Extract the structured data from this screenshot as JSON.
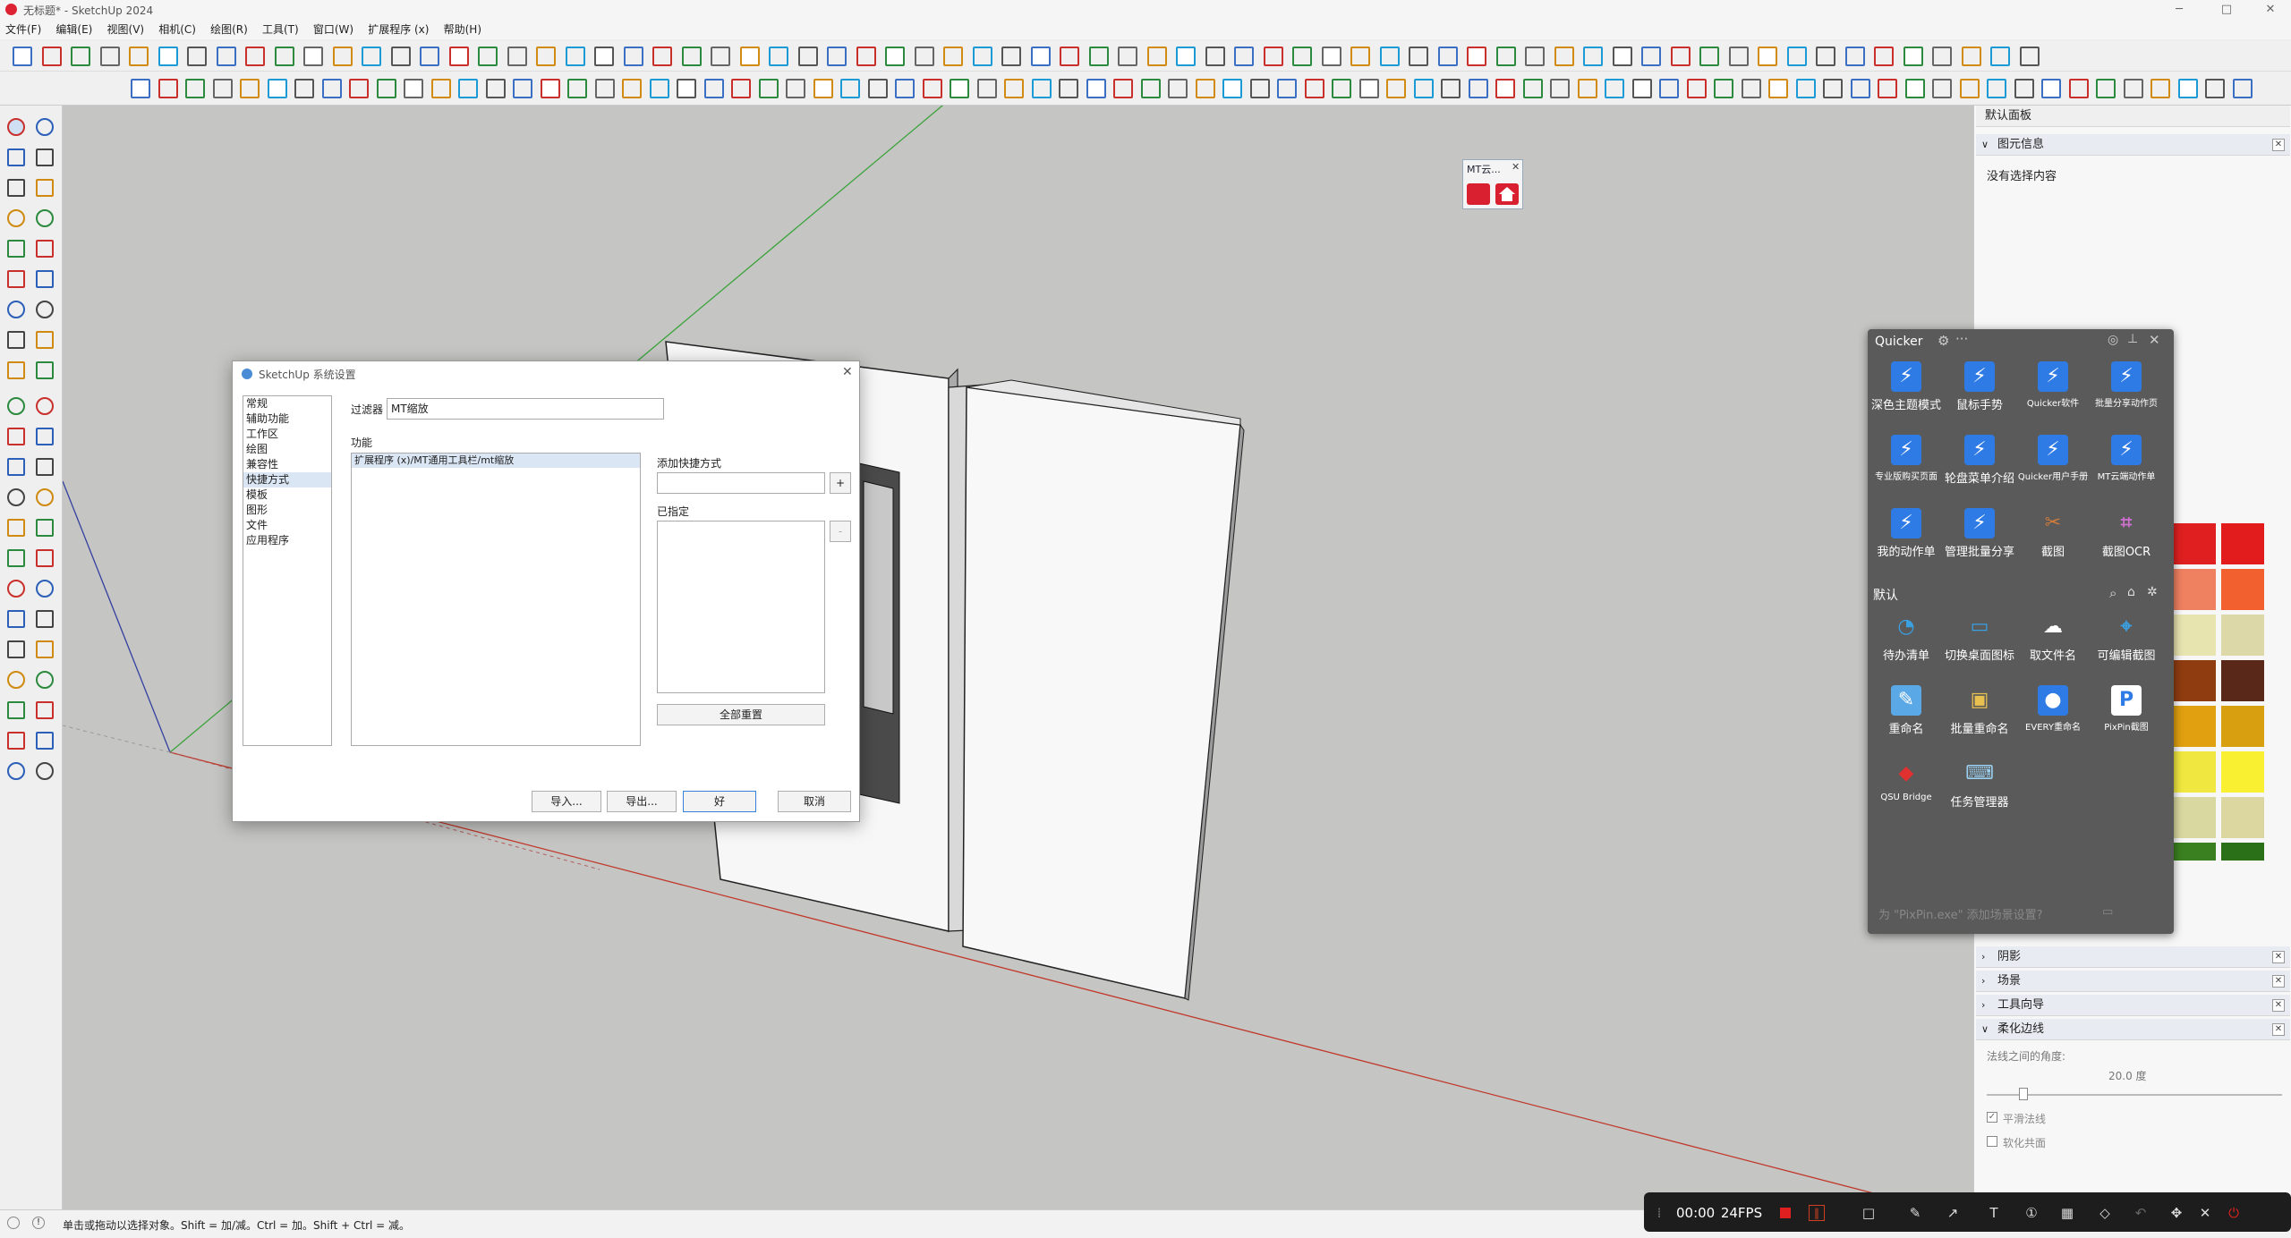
{
  "window": {
    "title": "无标题* - SketchUp 2024",
    "minimize": "─",
    "maximize": "□",
    "close": "✕"
  },
  "menu": [
    "文件(F)",
    "编辑(E)",
    "视图(V)",
    "相机(C)",
    "绘图(R)",
    "工具(T)",
    "窗口(W)",
    "扩展程序 (x)",
    "帮助(H)"
  ],
  "mt_panel": {
    "title": "MT云...",
    "close": "✕"
  },
  "dialog": {
    "title": "SketchUp 系统设置",
    "close": "✕",
    "nav": [
      "常规",
      "辅助功能",
      "工作区",
      "绘图",
      "兼容性",
      "快捷方式",
      "模板",
      "图形",
      "文件",
      "应用程序"
    ],
    "selected_nav": "快捷方式",
    "filter_label": "过滤器",
    "filter_value": "MT缩放",
    "function_label": "功能",
    "function_item": "扩展程序 (x)/MT通用工具栏/mt缩放",
    "add_shortcut_label": "添加快捷方式",
    "add_btn": "+",
    "assigned_label": "已指定",
    "remove_btn": "-",
    "reset_all": "全部重置",
    "import": "导入...",
    "export": "导出...",
    "ok": "好",
    "cancel": "取消"
  },
  "right_panel": {
    "title": "默认面板",
    "entity_info": "图元信息",
    "no_selection": "没有选择内容",
    "rows": [
      "阴影",
      "场景",
      "工具向导",
      "柔化边线"
    ],
    "soften_angle_label": "法线之间的角度:",
    "soften_angle_value": "20.0  度",
    "smooth_normals": "平滑法线",
    "soften_coplanar": "软化共面"
  },
  "quicker": {
    "title": "Quicker",
    "section_default": "默认",
    "top_items": [
      {
        "label": "深色主题模式",
        "icon": "lightning-icon"
      },
      {
        "label": "鼠标手势",
        "icon": "lightning-icon"
      },
      {
        "label": "Quicker软件",
        "icon": "lightning-icon"
      },
      {
        "label": "批量分享动作页",
        "icon": "lightning-icon"
      },
      {
        "label": "专业版购买页面",
        "icon": "lightning-icon"
      },
      {
        "label": "轮盘菜单介绍",
        "icon": "lightning-icon"
      },
      {
        "label": "Quicker用户手册",
        "icon": "lightning-icon"
      },
      {
        "label": "MT云端动作单",
        "icon": "lightning-icon"
      },
      {
        "label": "我的动作单",
        "icon": "lightning-icon"
      },
      {
        "label": "管理批量分享",
        "icon": "lightning-icon"
      },
      {
        "label": "截图",
        "icon": "scissors-icon"
      },
      {
        "label": "截图OCR",
        "icon": "ocr-icon"
      }
    ],
    "default_items": [
      {
        "label": "待办清单",
        "icon": "todo-icon"
      },
      {
        "label": "切换桌面图标",
        "icon": "monitor-icon"
      },
      {
        "label": "取文件名",
        "icon": "cloud-icon"
      },
      {
        "label": "可编辑截图",
        "icon": "crop-icon"
      },
      {
        "label": "重命名",
        "icon": "rename-icon"
      },
      {
        "label": "批量重命名",
        "icon": "batch-rename-icon"
      },
      {
        "label": "EVERY重命名",
        "icon": "everything-icon"
      },
      {
        "label": "PixPin截图",
        "icon": "pixpin-icon"
      },
      {
        "label": "QSU Bridge",
        "icon": "sketchup-icon"
      },
      {
        "label": "任务管理器",
        "icon": "keyboard-icon"
      }
    ],
    "footer_hint": "为 \"PixPin.exe\" 添加场景设置?"
  },
  "status": {
    "hint": "单击或拖动以选择对象。Shift = 加/减。Ctrl = 加。Shift + Ctrl = 减。"
  },
  "recorder": {
    "time": "00:00",
    "fps": "24FPS"
  },
  "colors": {
    "accent": "#2f7be5",
    "quicker_bg": "#5a5a5a",
    "viewport_bg": "#c5c5c3",
    "axis_red": "#c0392b",
    "axis_green": "#3aa33a",
    "axis_blue": "#3340a0"
  }
}
